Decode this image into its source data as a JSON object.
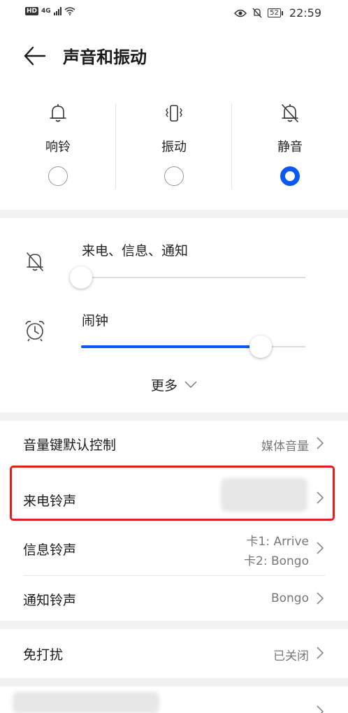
{
  "status_bar": {
    "hd": "HD",
    "network": "4G",
    "battery": "52",
    "time": "22:59"
  },
  "header": {
    "title": "声音和振动"
  },
  "modes": [
    {
      "label": "响铃",
      "icon": "bell-icon",
      "selected": false
    },
    {
      "label": "振动",
      "icon": "vibrate-icon",
      "selected": false
    },
    {
      "label": "静音",
      "icon": "bell-off-icon",
      "selected": true
    }
  ],
  "volume": {
    "sliders": [
      {
        "label": "来电、信息、通知",
        "icon": "bell-off-icon",
        "level": 0.0
      },
      {
        "label": "闹钟",
        "icon": "alarm-clock-icon",
        "level": 0.8
      }
    ],
    "more_label": "更多"
  },
  "settings": {
    "volume_key": {
      "label": "音量键默认控制",
      "value": "媒体音量"
    },
    "ringtone": {
      "label": "来电铃声",
      "value": ""
    },
    "message_tone": {
      "label": "信息铃声",
      "value_line1": "卡1: Arrive",
      "value_line2": "卡2: Bongo"
    },
    "notification_tone": {
      "label": "通知铃声",
      "value": "Bongo"
    },
    "do_not_disturb": {
      "label": "免打扰",
      "value": "已关闭"
    }
  },
  "colors": {
    "accent": "#0a59f7",
    "highlight": "#e0201c",
    "background": "#f2f2f2"
  }
}
